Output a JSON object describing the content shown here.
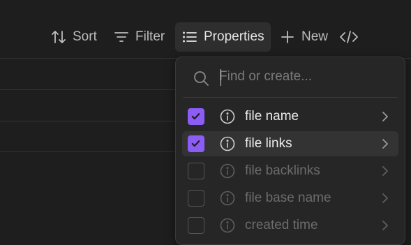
{
  "toolbar": {
    "sort_label": "Sort",
    "filter_label": "Filter",
    "properties_label": "Properties",
    "new_label": "New",
    "icons": {
      "sort": "sort-arrows-icon",
      "filter": "filter-lines-icon",
      "properties": "list-icon",
      "new": "plus-icon",
      "code": "code-brackets-icon"
    }
  },
  "properties_menu": {
    "search_placeholder": "Find or create...",
    "search_value": "",
    "items": [
      {
        "label": "file name",
        "checked": true
      },
      {
        "label": "file links",
        "checked": true
      },
      {
        "label": "file backlinks",
        "checked": false
      },
      {
        "label": "file base name",
        "checked": false
      },
      {
        "label": "created time",
        "checked": false
      }
    ]
  },
  "colors": {
    "background": "#1e1e1e",
    "panel": "#262626",
    "accent": "#8b5cf6",
    "text": "#dadada",
    "muted_text": "#6c6c6c"
  }
}
